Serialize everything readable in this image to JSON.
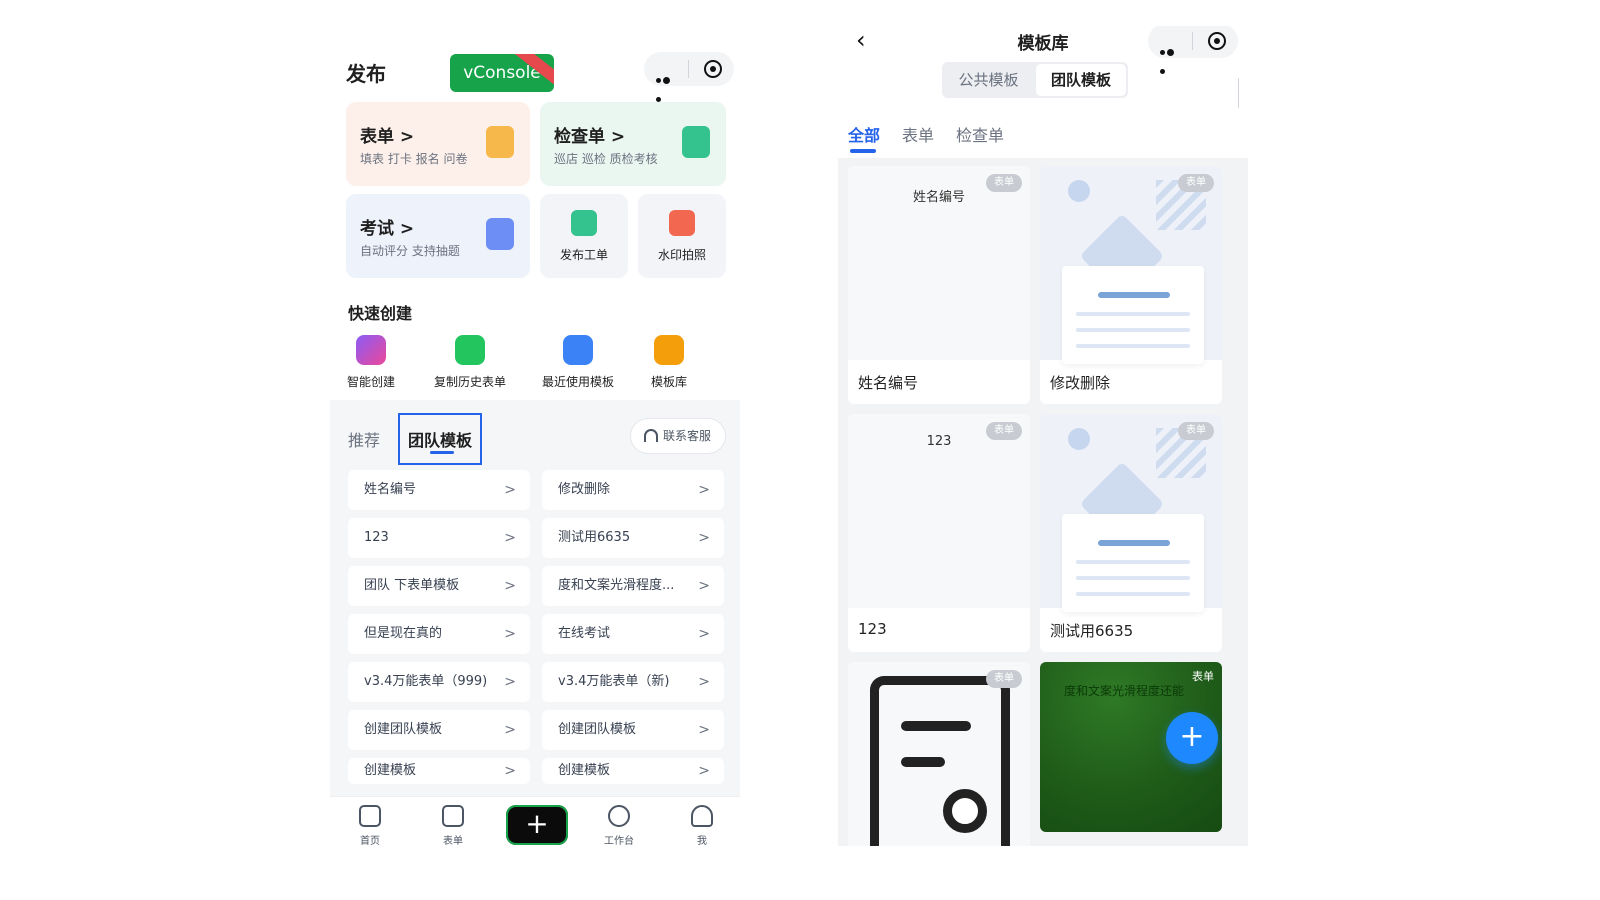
{
  "left": {
    "title": "发布",
    "vconsole_label": "vConsole",
    "cards": {
      "form": {
        "title": "表单 >",
        "subtitle": "填表 打卡 报名 问卷"
      },
      "check": {
        "title": "检查单 >",
        "subtitle": "巡店 巡检 质检考核"
      },
      "exam": {
        "title": "考试 >",
        "subtitle": "自动评分 支持抽题"
      },
      "ticket": {
        "label": "发布工单"
      },
      "photo": {
        "label": "水印拍照"
      }
    },
    "quick_title": "快速创建",
    "quick": [
      "智能创建",
      "复制历史表单",
      "最近使用模板",
      "模板库"
    ],
    "tabs": {
      "recommend": "推荐",
      "team": "团队模板"
    },
    "contact": "联系客服",
    "list_left": [
      "姓名编号",
      "123",
      "团队 下表单模板",
      "但是现在真的",
      "v3.4万能表单（999)",
      "创建团队模板",
      "创建模板"
    ],
    "list_right": [
      "修改删除",
      "测试用6635",
      "度和文案光滑程度...",
      "在线考试",
      "v3.4万能表单（新)",
      "创建团队模板",
      "创建模板"
    ],
    "tabbar": [
      "首页",
      "表单",
      "工作台",
      "我"
    ]
  },
  "right": {
    "title": "模板库",
    "segments": [
      "公共模板",
      "团队模板"
    ],
    "filters": [
      "全部",
      "表单",
      "检查单"
    ],
    "badge": "表单",
    "cards": [
      {
        "name": "姓名编号",
        "thumb_text": "姓名编号"
      },
      {
        "name": "修改删除"
      },
      {
        "name": "123",
        "thumb_text": "123"
      },
      {
        "name": "测试用6635"
      }
    ],
    "green_card_text": "度和文案光滑程度还能"
  },
  "colors": {
    "accent": "#2563eb",
    "vconsole": "#16a34a",
    "fab": "#1e88ff"
  }
}
